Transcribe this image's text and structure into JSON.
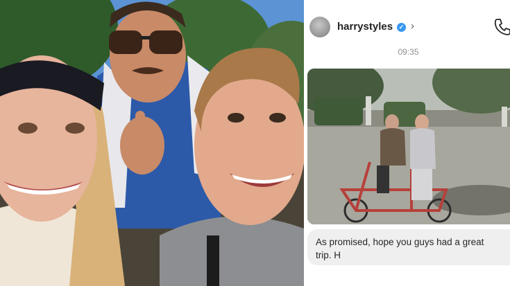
{
  "chat": {
    "username": "harrystyles",
    "verified_mark": "✓",
    "chevron": "›",
    "timestamp": "09:35",
    "message_text": "As promised, hope you guys had a great trip. H"
  },
  "icons": {
    "header_right": "phone-icon",
    "verified": "verified-badge-icon"
  },
  "colors": {
    "verified_blue": "#3897f0",
    "caption_bg": "#efefef",
    "timestamp_grey": "#8e8e8e"
  }
}
